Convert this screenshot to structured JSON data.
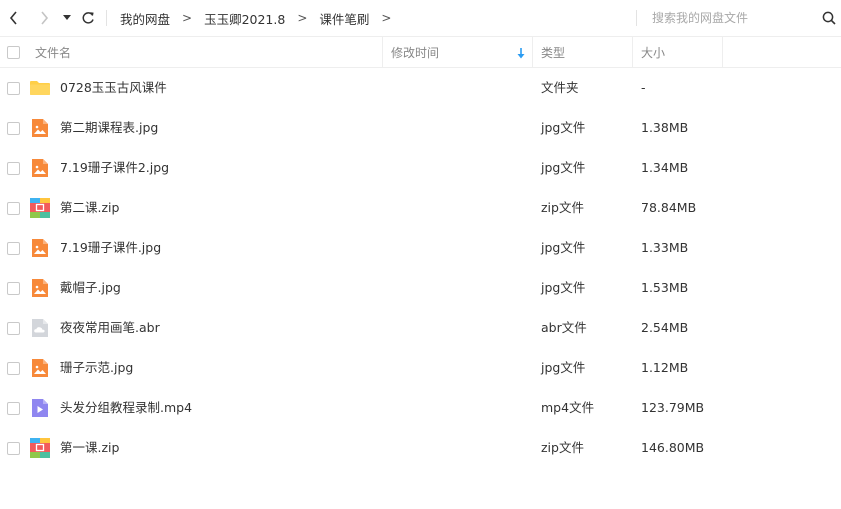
{
  "toolbar": {
    "breadcrumb": [
      "我的网盘",
      "玉玉卿2021.8",
      "课件笔刷"
    ],
    "separator": ">",
    "search_placeholder": "搜索我的网盘文件"
  },
  "columns": {
    "name": "文件名",
    "modified": "修改时间",
    "type": "类型",
    "size": "大小"
  },
  "files": [
    {
      "name": "0728玉玉古风课件",
      "modified": "",
      "type": "文件夹",
      "size": "-",
      "icon": "folder-icon"
    },
    {
      "name": "第二期课程表.jpg",
      "modified": "",
      "type": "jpg文件",
      "size": "1.38MB",
      "icon": "image-file-icon"
    },
    {
      "name": "7.19珊子课件2.jpg",
      "modified": "",
      "type": "jpg文件",
      "size": "1.34MB",
      "icon": "image-file-icon"
    },
    {
      "name": "第二课.zip",
      "modified": "",
      "type": "zip文件",
      "size": "78.84MB",
      "icon": "zip-file-icon"
    },
    {
      "name": "7.19珊子课件.jpg",
      "modified": "",
      "type": "jpg文件",
      "size": "1.33MB",
      "icon": "image-file-icon"
    },
    {
      "name": "戴帽子.jpg",
      "modified": "",
      "type": "jpg文件",
      "size": "1.53MB",
      "icon": "image-file-icon"
    },
    {
      "name": "夜夜常用画笔.abr",
      "modified": "",
      "type": "abr文件",
      "size": "2.54MB",
      "icon": "unknown-file-icon"
    },
    {
      "name": "珊子示范.jpg",
      "modified": "",
      "type": "jpg文件",
      "size": "1.12MB",
      "icon": "image-file-icon"
    },
    {
      "name": "头发分组教程录制.mp4",
      "modified": "",
      "type": "mp4文件",
      "size": "123.79MB",
      "icon": "video-file-icon"
    },
    {
      "name": "第一课.zip",
      "modified": "",
      "type": "zip文件",
      "size": "146.80MB",
      "icon": "zip-file-icon"
    }
  ],
  "colors": {
    "folder": "#ffcf48",
    "image": "#f7893a",
    "video": "#8f86f0",
    "sort_arrow": "#2b9cf2",
    "unknown": "#d3d6db"
  }
}
